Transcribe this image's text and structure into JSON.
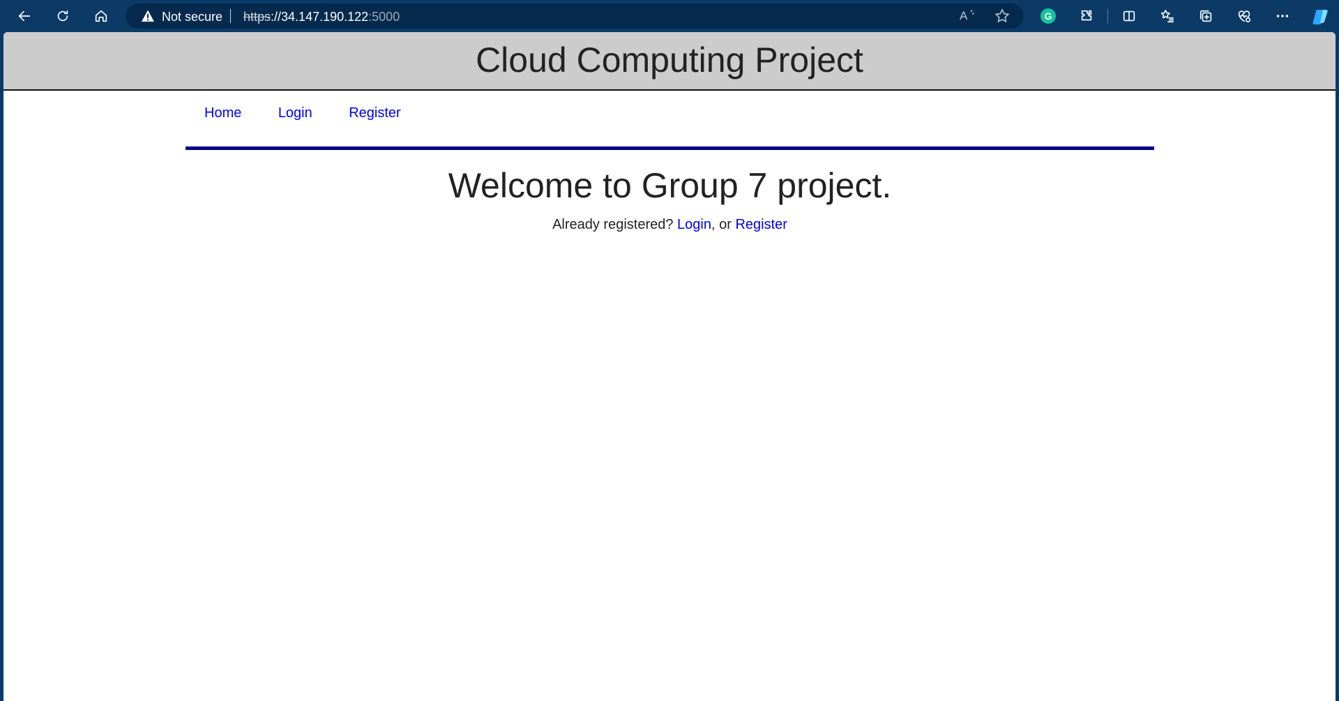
{
  "browser": {
    "security_label": "Not secure",
    "url_scheme": "https",
    "url_host": "://34.147.190.122",
    "url_port": ":5000",
    "read_aloud_label": "A",
    "grammarly_letter": "G"
  },
  "header": {
    "title": "Cloud Computing Project"
  },
  "nav": {
    "items": [
      {
        "label": "Home"
      },
      {
        "label": "Login"
      },
      {
        "label": "Register"
      }
    ]
  },
  "main": {
    "heading": "Welcome to Group 7 project.",
    "prompt_text": "Already registered? ",
    "login_link": "Login",
    "separator": ", or ",
    "register_link": "Register"
  },
  "colors": {
    "browser_frame": "#0b3a66",
    "header_bg": "#cccccc",
    "nav_rule": "#00008b",
    "link": "#0000ee"
  }
}
